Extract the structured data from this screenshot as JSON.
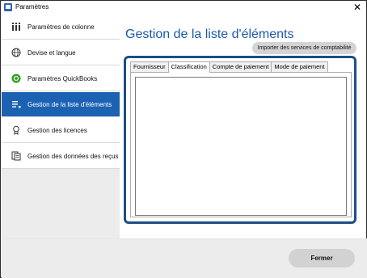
{
  "window": {
    "title": "Paramètres",
    "close_glyph": "✕"
  },
  "sidebar": {
    "items": [
      {
        "label": "Paramètres de colonne",
        "icon": "columns-icon"
      },
      {
        "label": "Devise et langue",
        "icon": "globe-icon"
      },
      {
        "label": "Paramètres QuickBooks",
        "icon": "quickbooks-icon"
      },
      {
        "label": "Gestion de la liste d'éléments",
        "icon": "list-icon",
        "active": true
      },
      {
        "label": "Gestion des licences",
        "icon": "license-icon"
      },
      {
        "label": "Gestion des données des reçus",
        "icon": "receipt-data-icon"
      }
    ]
  },
  "main": {
    "title": "Gestion de la liste d'éléments",
    "import_button": "Importer des services de comptabilité",
    "tabs": [
      {
        "label": "Fournisseur"
      },
      {
        "label": "Classification",
        "selected": true
      },
      {
        "label": "Compte de paiement"
      },
      {
        "label": "Mode de paiement"
      }
    ]
  },
  "footer": {
    "close_button": "Fermer"
  },
  "colors": {
    "accent": "#1c62b3",
    "title_blue": "#1c5aa8",
    "frame_border": "#1b4f87",
    "quickbooks_green": "#2ca01c"
  }
}
